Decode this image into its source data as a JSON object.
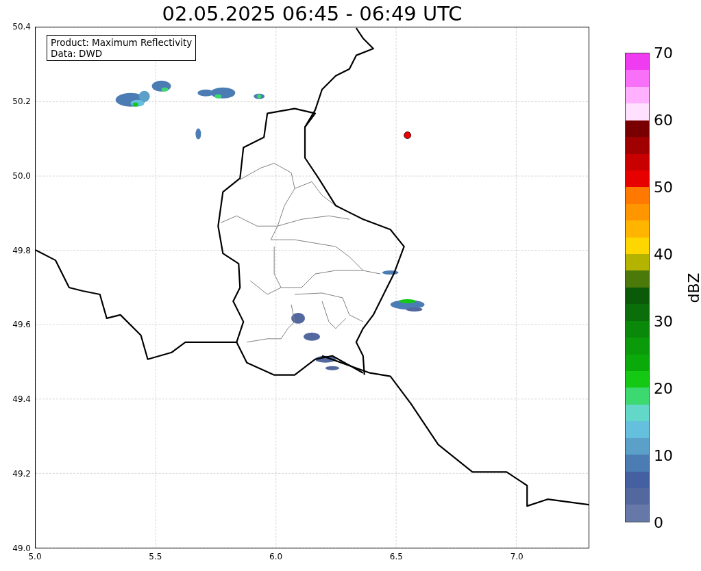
{
  "title": "02.05.2025 06:45 - 06:49 UTC",
  "map": {
    "legend": [
      "Product: Maximum Reflectivity",
      "Data: DWD"
    ],
    "xticks": [
      "5.0",
      "5.5",
      "6.0",
      "6.5",
      "7.0"
    ],
    "yticks": [
      "50.4",
      "50.2",
      "50.0",
      "49.8",
      "49.6",
      "49.4",
      "49.2",
      "49.0"
    ]
  },
  "colorbar": {
    "label": "dBZ",
    "ticks": [
      "70",
      "60",
      "50",
      "40",
      "30",
      "20",
      "10",
      "0"
    ],
    "segments": [
      {
        "color": "#f03cf0"
      },
      {
        "color": "#f870f8"
      },
      {
        "color": "#ffb0ff"
      },
      {
        "color": "#ffe0ff"
      },
      {
        "color": "#780000"
      },
      {
        "color": "#a00000"
      },
      {
        "color": "#c80000"
      },
      {
        "color": "#e60000"
      },
      {
        "color": "#ff7800"
      },
      {
        "color": "#ff9600"
      },
      {
        "color": "#ffb400"
      },
      {
        "color": "#ffd700"
      },
      {
        "color": "#b4b400"
      },
      {
        "color": "#4b7a0a"
      },
      {
        "color": "#0a5a0a"
      },
      {
        "color": "#0a6e0a"
      },
      {
        "color": "#0a880a"
      },
      {
        "color": "#0a9a0a"
      },
      {
        "color": "#0aaa0a"
      },
      {
        "color": "#14c814"
      },
      {
        "color": "#3cd870"
      },
      {
        "color": "#64d8c8"
      },
      {
        "color": "#64c0dc"
      },
      {
        "color": "#5aa0c8"
      },
      {
        "color": "#4c7cb4"
      },
      {
        "color": "#4460a0"
      },
      {
        "color": "#5468a0"
      },
      {
        "color": "#6678a8"
      }
    ]
  }
}
